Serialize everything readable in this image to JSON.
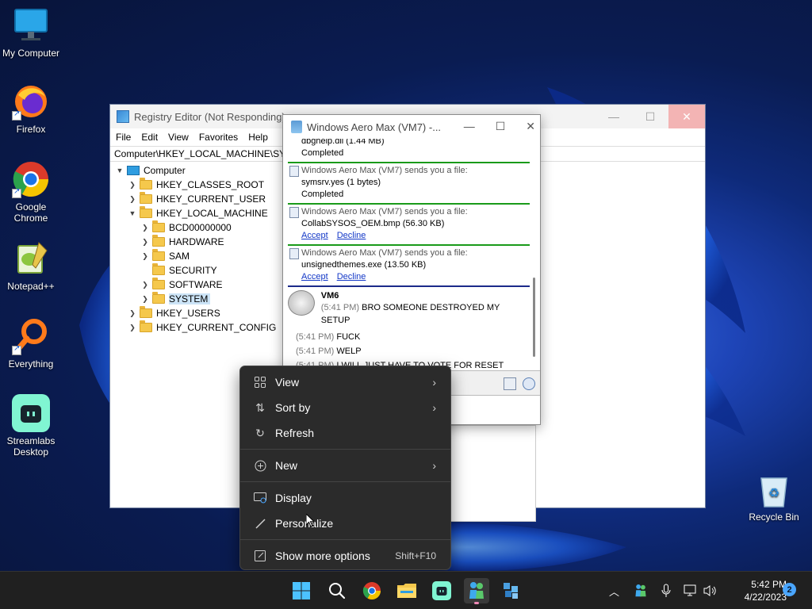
{
  "desktop": {
    "icons": [
      {
        "label": "My Computer",
        "icon": "computer-icon"
      },
      {
        "label": "Firefox",
        "icon": "firefox-icon"
      },
      {
        "label": "Google Chrome",
        "icon": "chrome-icon"
      },
      {
        "label": "Notepad++",
        "icon": "notepadpp-icon"
      },
      {
        "label": "Everything",
        "icon": "everything-icon"
      },
      {
        "label": "Streamlabs Desktop",
        "icon": "streamlabs-icon"
      }
    ],
    "recycle_bin": "Recycle Bin"
  },
  "regedit": {
    "title": "Registry Editor (Not Responding)",
    "menu": [
      "File",
      "Edit",
      "View",
      "Favorites",
      "Help"
    ],
    "address": "Computer\\HKEY_LOCAL_MACHINE\\SYSTEM",
    "tree": {
      "root": "Computer",
      "hkcr": "HKEY_CLASSES_ROOT",
      "hkcu": "HKEY_CURRENT_USER",
      "hklm": "HKEY_LOCAL_MACHINE",
      "hklm_children": [
        "BCD00000000",
        "HARDWARE",
        "SAM",
        "SECURITY",
        "SOFTWARE",
        "SYSTEM"
      ],
      "hku": "HKEY_USERS",
      "hkcc": "HKEY_CURRENT_CONFIG"
    }
  },
  "chat": {
    "title": "Windows Aero Max (VM7) -...",
    "partial_top": {
      "file": "dbghelp.dll (1.44 MB)",
      "status": "Completed"
    },
    "transfers": [
      {
        "head": "Windows Aero Max (VM7) sends you a file:",
        "file": "symsrv.yes (1 bytes)",
        "status": "Completed"
      },
      {
        "head": "Windows Aero Max (VM7) sends you a file:",
        "file": "CollabSYSOS_OEM.bmp (56.30 KB)",
        "accept": "Accept",
        "decline": "Decline"
      },
      {
        "head": "Windows Aero Max (VM7) sends you a file:",
        "file": "unsignedthemes.exe (13.50 KB)",
        "accept": "Accept",
        "decline": "Decline"
      }
    ],
    "sender": "VM6",
    "messages": [
      {
        "time": "(5:41 PM)",
        "text": "BRO SOMEONE DESTROYED MY SETUP"
      },
      {
        "time": "(5:41 PM)",
        "text": "FUCK"
      },
      {
        "time": "(5:41 PM)",
        "text": "WELP"
      },
      {
        "time": "(5:41 PM)",
        "text": "I WILL JUST HAVE TO VOTE FOR RESET"
      }
    ]
  },
  "context_menu": {
    "view": "View",
    "sort_by": "Sort by",
    "refresh": "Refresh",
    "new": "New",
    "display": "Display",
    "personalize": "Personalize",
    "show_more": "Show more options",
    "show_more_shortcut": "Shift+F10"
  },
  "taskbar": {
    "time": "5:42 PM",
    "date": "4/22/2023",
    "notifications": "2",
    "colors": {
      "bar": "#202020",
      "accent": "#4aa6ff"
    }
  }
}
